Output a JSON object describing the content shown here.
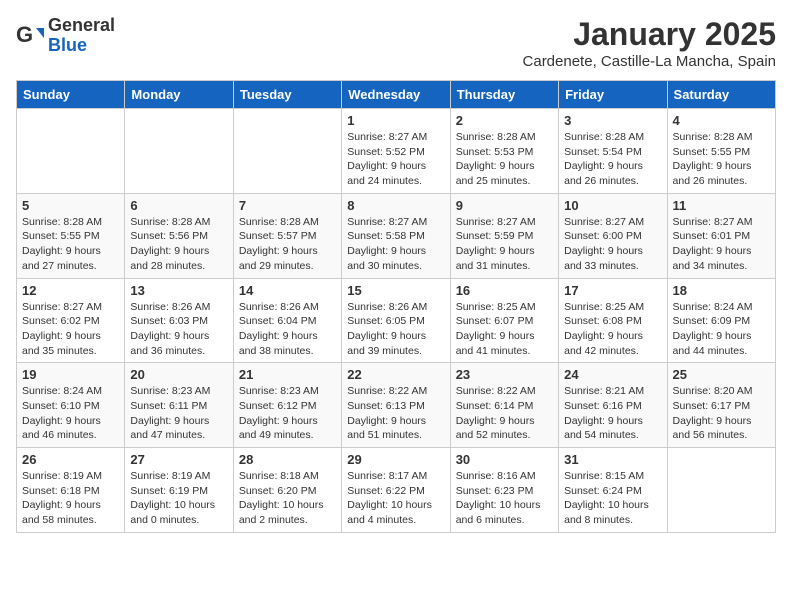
{
  "logo": {
    "general": "General",
    "blue": "Blue"
  },
  "title": "January 2025",
  "location": "Cardenete, Castille-La Mancha, Spain",
  "weekdays": [
    "Sunday",
    "Monday",
    "Tuesday",
    "Wednesday",
    "Thursday",
    "Friday",
    "Saturday"
  ],
  "weeks": [
    [
      {
        "day": "",
        "content": ""
      },
      {
        "day": "",
        "content": ""
      },
      {
        "day": "",
        "content": ""
      },
      {
        "day": "1",
        "content": "Sunrise: 8:27 AM\nSunset: 5:52 PM\nDaylight: 9 hours and 24 minutes."
      },
      {
        "day": "2",
        "content": "Sunrise: 8:28 AM\nSunset: 5:53 PM\nDaylight: 9 hours and 25 minutes."
      },
      {
        "day": "3",
        "content": "Sunrise: 8:28 AM\nSunset: 5:54 PM\nDaylight: 9 hours and 26 minutes."
      },
      {
        "day": "4",
        "content": "Sunrise: 8:28 AM\nSunset: 5:55 PM\nDaylight: 9 hours and 26 minutes."
      }
    ],
    [
      {
        "day": "5",
        "content": "Sunrise: 8:28 AM\nSunset: 5:55 PM\nDaylight: 9 hours and 27 minutes."
      },
      {
        "day": "6",
        "content": "Sunrise: 8:28 AM\nSunset: 5:56 PM\nDaylight: 9 hours and 28 minutes."
      },
      {
        "day": "7",
        "content": "Sunrise: 8:28 AM\nSunset: 5:57 PM\nDaylight: 9 hours and 29 minutes."
      },
      {
        "day": "8",
        "content": "Sunrise: 8:27 AM\nSunset: 5:58 PM\nDaylight: 9 hours and 30 minutes."
      },
      {
        "day": "9",
        "content": "Sunrise: 8:27 AM\nSunset: 5:59 PM\nDaylight: 9 hours and 31 minutes."
      },
      {
        "day": "10",
        "content": "Sunrise: 8:27 AM\nSunset: 6:00 PM\nDaylight: 9 hours and 33 minutes."
      },
      {
        "day": "11",
        "content": "Sunrise: 8:27 AM\nSunset: 6:01 PM\nDaylight: 9 hours and 34 minutes."
      }
    ],
    [
      {
        "day": "12",
        "content": "Sunrise: 8:27 AM\nSunset: 6:02 PM\nDaylight: 9 hours and 35 minutes."
      },
      {
        "day": "13",
        "content": "Sunrise: 8:26 AM\nSunset: 6:03 PM\nDaylight: 9 hours and 36 minutes."
      },
      {
        "day": "14",
        "content": "Sunrise: 8:26 AM\nSunset: 6:04 PM\nDaylight: 9 hours and 38 minutes."
      },
      {
        "day": "15",
        "content": "Sunrise: 8:26 AM\nSunset: 6:05 PM\nDaylight: 9 hours and 39 minutes."
      },
      {
        "day": "16",
        "content": "Sunrise: 8:25 AM\nSunset: 6:07 PM\nDaylight: 9 hours and 41 minutes."
      },
      {
        "day": "17",
        "content": "Sunrise: 8:25 AM\nSunset: 6:08 PM\nDaylight: 9 hours and 42 minutes."
      },
      {
        "day": "18",
        "content": "Sunrise: 8:24 AM\nSunset: 6:09 PM\nDaylight: 9 hours and 44 minutes."
      }
    ],
    [
      {
        "day": "19",
        "content": "Sunrise: 8:24 AM\nSunset: 6:10 PM\nDaylight: 9 hours and 46 minutes."
      },
      {
        "day": "20",
        "content": "Sunrise: 8:23 AM\nSunset: 6:11 PM\nDaylight: 9 hours and 47 minutes."
      },
      {
        "day": "21",
        "content": "Sunrise: 8:23 AM\nSunset: 6:12 PM\nDaylight: 9 hours and 49 minutes."
      },
      {
        "day": "22",
        "content": "Sunrise: 8:22 AM\nSunset: 6:13 PM\nDaylight: 9 hours and 51 minutes."
      },
      {
        "day": "23",
        "content": "Sunrise: 8:22 AM\nSunset: 6:14 PM\nDaylight: 9 hours and 52 minutes."
      },
      {
        "day": "24",
        "content": "Sunrise: 8:21 AM\nSunset: 6:16 PM\nDaylight: 9 hours and 54 minutes."
      },
      {
        "day": "25",
        "content": "Sunrise: 8:20 AM\nSunset: 6:17 PM\nDaylight: 9 hours and 56 minutes."
      }
    ],
    [
      {
        "day": "26",
        "content": "Sunrise: 8:19 AM\nSunset: 6:18 PM\nDaylight: 9 hours and 58 minutes."
      },
      {
        "day": "27",
        "content": "Sunrise: 8:19 AM\nSunset: 6:19 PM\nDaylight: 10 hours and 0 minutes."
      },
      {
        "day": "28",
        "content": "Sunrise: 8:18 AM\nSunset: 6:20 PM\nDaylight: 10 hours and 2 minutes."
      },
      {
        "day": "29",
        "content": "Sunrise: 8:17 AM\nSunset: 6:22 PM\nDaylight: 10 hours and 4 minutes."
      },
      {
        "day": "30",
        "content": "Sunrise: 8:16 AM\nSunset: 6:23 PM\nDaylight: 10 hours and 6 minutes."
      },
      {
        "day": "31",
        "content": "Sunrise: 8:15 AM\nSunset: 6:24 PM\nDaylight: 10 hours and 8 minutes."
      },
      {
        "day": "",
        "content": ""
      }
    ]
  ]
}
